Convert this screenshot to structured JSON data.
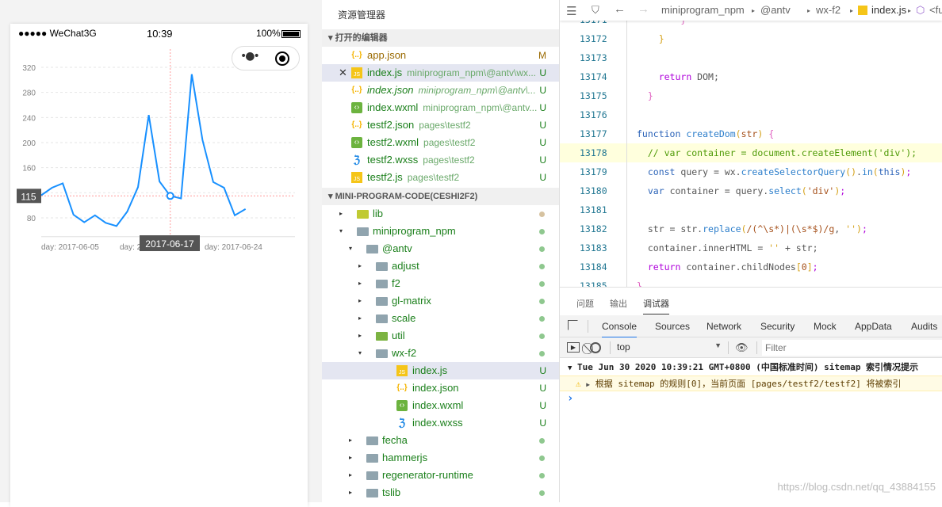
{
  "simulator": {
    "carrier": "●●●●● WeChat3G",
    "time": "10:39",
    "battery": "100%"
  },
  "chart_data": {
    "type": "line",
    "x": [
      "2017-06-05",
      "2017-06-06",
      "2017-06-07",
      "2017-06-08",
      "2017-06-09",
      "2017-06-10",
      "2017-06-11",
      "2017-06-12",
      "2017-06-13",
      "2017-06-14",
      "2017-06-15",
      "2017-06-16",
      "2017-06-17",
      "2017-06-18",
      "2017-06-19",
      "2017-06-20",
      "2017-06-21",
      "2017-06-22",
      "2017-06-23",
      "2017-06-24"
    ],
    "values": [
      116,
      128,
      135,
      85,
      73,
      84,
      72,
      67,
      90,
      129,
      244,
      138,
      115,
      111,
      309,
      204,
      137,
      128,
      84,
      94
    ],
    "ylim": [
      50,
      340
    ],
    "yticks": [
      80,
      120,
      160,
      200,
      240,
      280,
      320
    ],
    "xtick_labels": [
      "day: 2017-06-05",
      "day: 2017-06-15",
      "day: 2017-06-24"
    ],
    "grid": true,
    "color": "#1890ff",
    "tooltip": {
      "x": "2017-06-17",
      "y": "115",
      "index": 12
    }
  },
  "explorer": {
    "title": "资源管理器",
    "open_editors": "打开的编辑器",
    "project": "MINI-PROGRAM-CODE(CESHI2F2)",
    "open": [
      {
        "name": "app.json",
        "path": "",
        "type": "json",
        "status": "M"
      },
      {
        "name": "index.js",
        "path": "miniprogram_npm\\@antv\\wx...",
        "type": "js",
        "status": "U",
        "selected": true
      },
      {
        "name": "index.json",
        "path": "miniprogram_npm\\@antv\\...",
        "type": "json",
        "status": "U"
      },
      {
        "name": "index.wxml",
        "path": "miniprogram_npm\\@antv...",
        "type": "wxml",
        "status": "U"
      },
      {
        "name": "testf2.json",
        "path": "pages\\testf2",
        "type": "json",
        "status": "U"
      },
      {
        "name": "testf2.wxml",
        "path": "pages\\testf2",
        "type": "wxml",
        "status": "U"
      },
      {
        "name": "testf2.wxss",
        "path": "pages\\testf2",
        "type": "wxss",
        "status": "U"
      },
      {
        "name": "testf2.js",
        "path": "pages\\testf2",
        "type": "js",
        "status": "U"
      }
    ],
    "tree": [
      {
        "name": "lib",
        "depth": 0,
        "type": "folder-lime",
        "caret": "▸"
      },
      {
        "name": "miniprogram_npm",
        "depth": 0,
        "type": "folder",
        "caret": "▾"
      },
      {
        "name": "@antv",
        "depth": 1,
        "type": "folder",
        "caret": "▾"
      },
      {
        "name": "adjust",
        "depth": 2,
        "type": "folder",
        "caret": "▸"
      },
      {
        "name": "f2",
        "depth": 2,
        "type": "folder",
        "caret": "▸"
      },
      {
        "name": "gl-matrix",
        "depth": 2,
        "type": "folder",
        "caret": "▸"
      },
      {
        "name": "scale",
        "depth": 2,
        "type": "folder",
        "caret": "▸"
      },
      {
        "name": "util",
        "depth": 2,
        "type": "folder-green",
        "caret": "▸"
      },
      {
        "name": "wx-f2",
        "depth": 2,
        "type": "folder",
        "caret": "▾"
      },
      {
        "name": "index.js",
        "depth": 3,
        "type": "js",
        "status": "U",
        "selected": true
      },
      {
        "name": "index.json",
        "depth": 3,
        "type": "json",
        "status": "U"
      },
      {
        "name": "index.wxml",
        "depth": 3,
        "type": "wxml",
        "status": "U"
      },
      {
        "name": "index.wxss",
        "depth": 3,
        "type": "wxss",
        "status": "U"
      },
      {
        "name": "fecha",
        "depth": 1,
        "type": "folder",
        "caret": "▸"
      },
      {
        "name": "hammerjs",
        "depth": 1,
        "type": "folder",
        "caret": "▸"
      },
      {
        "name": "regenerator-runtime",
        "depth": 1,
        "type": "folder",
        "caret": "▸"
      },
      {
        "name": "tslib",
        "depth": 1,
        "type": "folder",
        "caret": "▸"
      }
    ]
  },
  "editor": {
    "breadcrumb": [
      "miniprogram_npm",
      "@antv",
      "wx-f2",
      "index.js",
      "<func"
    ],
    "lines": [
      {
        "n": "13171",
        "tokens": [
          [
            "        ",
            ""
          ],
          [
            "}",
            "pk"
          ]
        ]
      },
      {
        "n": "13172",
        "tokens": [
          [
            "    ",
            ""
          ],
          [
            "}",
            "p"
          ]
        ]
      },
      {
        "n": "13173",
        "tokens": []
      },
      {
        "n": "13174",
        "tokens": [
          [
            "    ",
            ""
          ],
          [
            "return",
            "k"
          ],
          [
            " DOM;",
            "t"
          ]
        ]
      },
      {
        "n": "13175",
        "tokens": [
          [
            "  ",
            ""
          ],
          [
            "}",
            "pk"
          ]
        ]
      },
      {
        "n": "13176",
        "tokens": []
      },
      {
        "n": "13177",
        "tokens": [
          [
            "function",
            "v"
          ],
          [
            " ",
            ""
          ],
          [
            "createDom",
            "f"
          ],
          [
            "(",
            "p"
          ],
          [
            "str",
            "s"
          ],
          [
            ")",
            "p"
          ],
          [
            " ",
            ""
          ],
          [
            "{",
            "pk"
          ]
        ]
      },
      {
        "n": "13178",
        "hl": true,
        "tokens": [
          [
            "  // var container = document.createElement('div');",
            "c"
          ]
        ]
      },
      {
        "n": "13179",
        "tokens": [
          [
            "  ",
            ""
          ],
          [
            "const",
            "v"
          ],
          [
            " query = wx.",
            "t"
          ],
          [
            "createSelectorQuery",
            "f"
          ],
          [
            "()",
            "p"
          ],
          [
            ".",
            "t"
          ],
          [
            "in",
            "f"
          ],
          [
            "(",
            "p"
          ],
          [
            "this",
            "v"
          ],
          [
            ")",
            "p"
          ],
          [
            ";",
            "k"
          ]
        ]
      },
      {
        "n": "13180",
        "tokens": [
          [
            "  ",
            ""
          ],
          [
            "var",
            "v"
          ],
          [
            " container = query.",
            "t"
          ],
          [
            "select",
            "f"
          ],
          [
            "(",
            "p"
          ],
          [
            "'div'",
            "s"
          ],
          [
            ")",
            "p"
          ],
          [
            ";",
            "k"
          ]
        ]
      },
      {
        "n": "13181",
        "tokens": []
      },
      {
        "n": "13182",
        "tokens": [
          [
            "  str = str.",
            "t"
          ],
          [
            "replace",
            "f"
          ],
          [
            "(",
            "p"
          ],
          [
            "/(^\\s*)|(\\s*$)/g",
            "s"
          ],
          [
            ", ",
            "t"
          ],
          [
            "''",
            "p"
          ],
          [
            ")",
            "p"
          ],
          [
            ";",
            "k"
          ]
        ]
      },
      {
        "n": "13183",
        "tokens": [
          [
            "  container.innerHTML = ",
            "t"
          ],
          [
            "''",
            "p"
          ],
          [
            " + str;",
            "t"
          ]
        ]
      },
      {
        "n": "13184",
        "tokens": [
          [
            "  ",
            ""
          ],
          [
            "return",
            "k"
          ],
          [
            " container.childNodes",
            "t"
          ],
          [
            "[",
            "p"
          ],
          [
            "0",
            "s"
          ],
          [
            "]",
            "p"
          ],
          [
            ";",
            "k"
          ]
        ]
      },
      {
        "n": "13185",
        "tokens": [
          [
            "}",
            "pk"
          ]
        ]
      }
    ]
  },
  "panel": {
    "tabs": [
      "问题",
      "输出",
      "调试器"
    ],
    "devtools_tabs": [
      "Console",
      "Sources",
      "Network",
      "Security",
      "Mock",
      "AppData",
      "Audits"
    ],
    "context": "top",
    "filter_placeholder": "Filter",
    "log_header": "Tue Jun 30 2020 10:39:21 GMT+0800 (中国标准时间) sitemap 索引情况提示",
    "log_warning": "根据 sitemap 的规则[0]，当前页面 [pages/testf2/testf2] 将被索引",
    "prompt": "›"
  },
  "watermark": "https://blog.csdn.net/qq_43884155"
}
